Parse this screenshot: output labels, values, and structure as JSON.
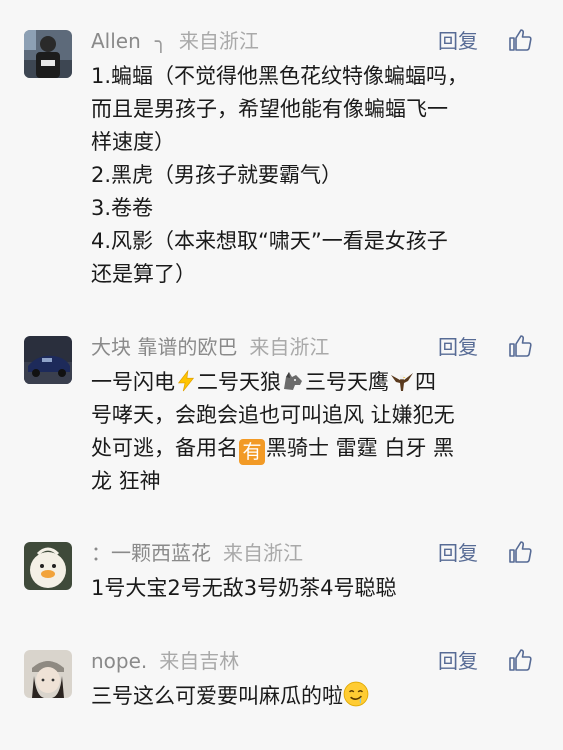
{
  "comments": [
    {
      "author": "Allen",
      "separator": "╮",
      "location": "来自浙江",
      "reply_label": "回复",
      "lines": [
        "1.蝙蝠（不觉得他黑色花纹特像蝙蝠吗，",
        "而且是男孩子，希望他能有像蝙蝠飞一",
        "样速度）",
        "2.黑虎（男孩子就要霸气）",
        "3.卷卷",
        "4.风影（本来想取“啸天”一看是女孩子",
        "还是算了）"
      ]
    },
    {
      "author": "大块 靠谱的欧巴",
      "location": "来自浙江",
      "reply_label": "回复",
      "line1_a": "一号闪电",
      "line1_b": "二号天狼",
      "line1_c": "三号天鹰",
      "line1_d": "四",
      "line2": "号哮天，会跑会追也可叫追风 让嫌犯无",
      "line3_a": "处可逃，备用名",
      "line3_badge": "有",
      "line3_b": "黑骑士 雷霆 白牙 黑",
      "line4": "龙 狂神"
    },
    {
      "author": "：一颗西蓝花",
      "location": "来自浙江",
      "reply_label": "回复",
      "line1": "1号大宝2号无敌3号奶茶4号聪聪"
    },
    {
      "author": "nope.",
      "location": "来自吉林",
      "reply_label": "回复",
      "line1": "三号这么可爱要叫麻瓜的啦"
    }
  ],
  "colors": {
    "background": "#f7f7f7",
    "name": "#8a8a8a",
    "reply": "#576b95",
    "text": "#1a1a1a"
  },
  "icons": [
    "thumbs-up-icon",
    "lightning-emoji",
    "wolf-emoji",
    "eagle-emoji",
    "you-badge",
    "drooling-face-emoji"
  ]
}
